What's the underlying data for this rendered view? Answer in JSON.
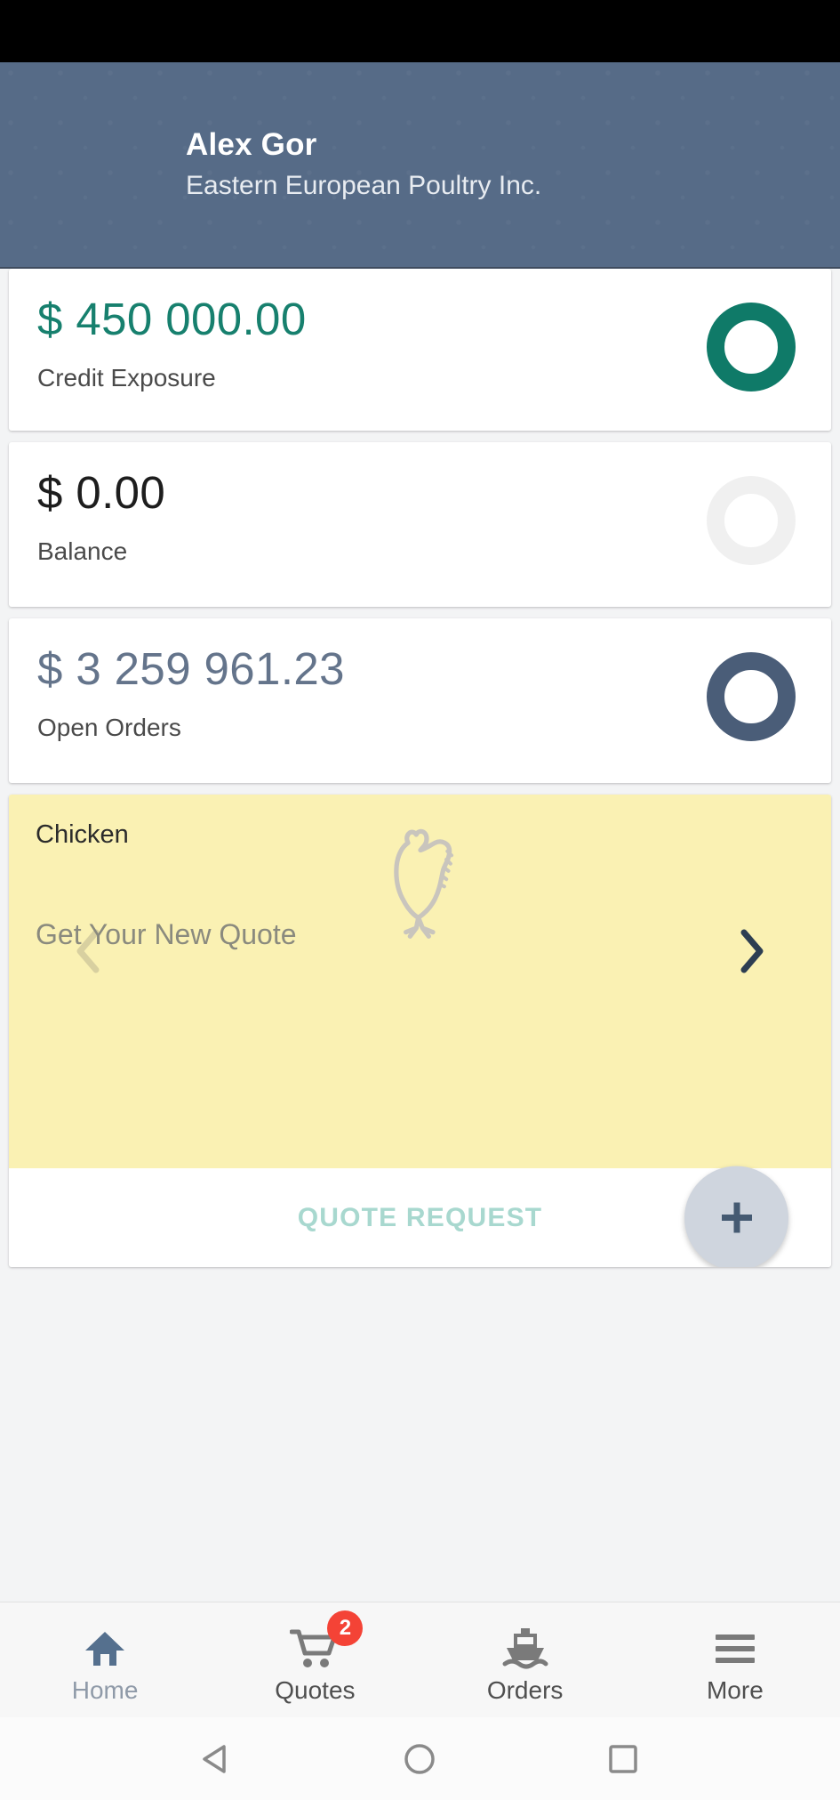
{
  "statusbar": {
    "name": "status-bar"
  },
  "header": {
    "user_name": "Alex Gor",
    "company": "Eastern European Poultry Inc.",
    "background_color": "#566b87"
  },
  "cards": [
    {
      "amount": "$ 450 000.00",
      "label": "Credit Exposure",
      "amount_color": "#17806e",
      "ring_color": "#0f7a68",
      "ring_size": 100,
      "ring_thickness": 20
    },
    {
      "amount": "$ 0.00",
      "label": "Balance",
      "amount_color": "#1d1d1d",
      "ring_color": "#f0f0f0",
      "ring_size": 100,
      "ring_thickness": 20
    },
    {
      "amount": "$ 3 259 961.23",
      "label": "Open Orders",
      "amount_color": "#64748b",
      "ring_color": "#4a5d78",
      "ring_size": 100,
      "ring_thickness": 20
    }
  ],
  "promo": {
    "title": "Chicken",
    "subtitle": "Get Your New Quote",
    "background_color": "#faf1b3",
    "art_icon": "chicken-outline-icon",
    "prev_label": "‹",
    "next_label": "›",
    "prev_color": "#d8d0a0",
    "next_color": "#2d3e52",
    "quote_request_label": "QUOTE REQUEST",
    "quote_request_color": "#a8d8cf",
    "fab_icon": "plus-icon",
    "fab_background": "#cfd5de",
    "fab_icon_color": "#455a72"
  },
  "bottom_nav": {
    "items": [
      {
        "label": "Home",
        "icon": "home-icon",
        "active": true,
        "badge": ""
      },
      {
        "label": "Quotes",
        "icon": "cart-icon",
        "active": false,
        "badge": "2"
      },
      {
        "label": "Orders",
        "icon": "ship-icon",
        "active": false,
        "badge": ""
      },
      {
        "label": "More",
        "icon": "hamburger-icon",
        "active": false,
        "badge": ""
      }
    ],
    "active_color": "#8f9aa8",
    "badge_color": "#f44336"
  },
  "system_nav": {
    "back": "back-triangle-icon",
    "home": "home-circle-icon",
    "recents": "recents-square-icon"
  }
}
